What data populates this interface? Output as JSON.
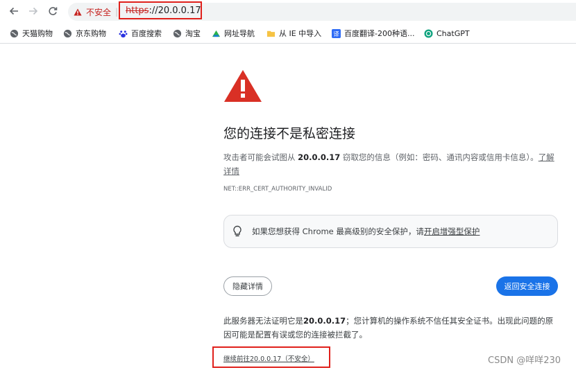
{
  "toolbar": {
    "back_icon": "arrow-left-icon",
    "forward_icon": "arrow-right-icon",
    "reload_icon": "reload-icon",
    "security_label": "不安全",
    "url_scheme": "https",
    "url_rest": "://20.0.0.17"
  },
  "bookmarks": [
    {
      "label": "天猫购物",
      "icon": "globe-icon"
    },
    {
      "label": "京东购物",
      "icon": "globe-icon"
    },
    {
      "label": "百度搜索",
      "icon": "baidu-paw-icon"
    },
    {
      "label": "淘宝",
      "icon": "globe-icon"
    },
    {
      "label": "网址导航",
      "icon": "hao123-icon"
    },
    {
      "label": "从 IE 中导入",
      "icon": "folder-icon"
    },
    {
      "label": "百度翻译-200种语...",
      "icon": "translate-icon"
    },
    {
      "label": "ChatGPT",
      "icon": "chatgpt-icon"
    }
  ],
  "interstitial": {
    "title": "您的连接不是私密连接",
    "desc_pre": "攻击者可能会试图从 ",
    "desc_host": "20.0.0.17",
    "desc_post": " 窃取您的信息（例如：密码、通讯内容或信用卡信息）。",
    "desc_link": "了解详情",
    "error_code": "NET::ERR_CERT_AUTHORITY_INVALID",
    "enhanced_pre": "如果您想获得 Chrome 最高级别的安全保护，请",
    "enhanced_link": "开启增强型保护",
    "details_button": "隐藏详情",
    "back_button": "返回安全连接",
    "details_pre": "此服务器无法证明它是",
    "details_host": "20.0.0.17",
    "details_post": "；您计算机的操作系统不信任其安全证书。出现此问题的原因可能是配置有误或您的连接被拦截了。",
    "proceed_link": "继续前往20.0.0.17（不安全）"
  },
  "watermark": "CSDN @咩咩230",
  "colors": {
    "danger": "#d93025",
    "primary": "#1a73e8",
    "highlight_box": "#e0201b"
  }
}
